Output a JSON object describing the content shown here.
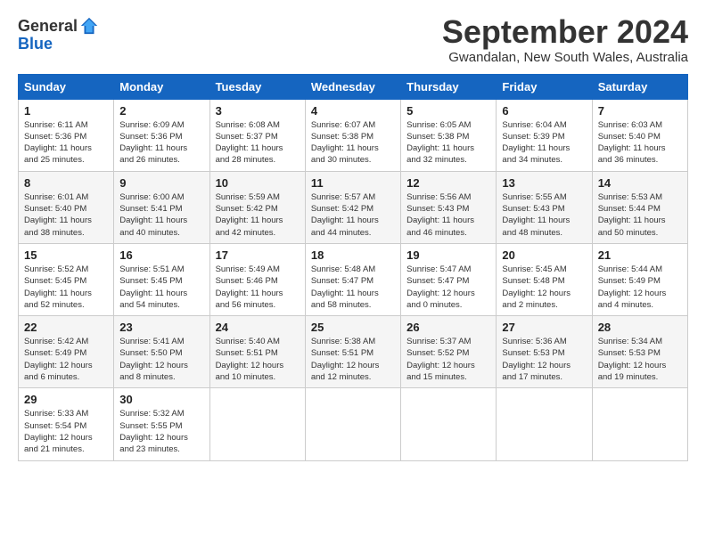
{
  "header": {
    "logo_general": "General",
    "logo_blue": "Blue",
    "month_title": "September 2024",
    "subtitle": "Gwandalan, New South Wales, Australia"
  },
  "days_of_week": [
    "Sunday",
    "Monday",
    "Tuesday",
    "Wednesday",
    "Thursday",
    "Friday",
    "Saturday"
  ],
  "weeks": [
    [
      {
        "day": "1",
        "info": "Sunrise: 6:11 AM\nSunset: 5:36 PM\nDaylight: 11 hours\nand 25 minutes."
      },
      {
        "day": "2",
        "info": "Sunrise: 6:09 AM\nSunset: 5:36 PM\nDaylight: 11 hours\nand 26 minutes."
      },
      {
        "day": "3",
        "info": "Sunrise: 6:08 AM\nSunset: 5:37 PM\nDaylight: 11 hours\nand 28 minutes."
      },
      {
        "day": "4",
        "info": "Sunrise: 6:07 AM\nSunset: 5:38 PM\nDaylight: 11 hours\nand 30 minutes."
      },
      {
        "day": "5",
        "info": "Sunrise: 6:05 AM\nSunset: 5:38 PM\nDaylight: 11 hours\nand 32 minutes."
      },
      {
        "day": "6",
        "info": "Sunrise: 6:04 AM\nSunset: 5:39 PM\nDaylight: 11 hours\nand 34 minutes."
      },
      {
        "day": "7",
        "info": "Sunrise: 6:03 AM\nSunset: 5:40 PM\nDaylight: 11 hours\nand 36 minutes."
      }
    ],
    [
      {
        "day": "8",
        "info": "Sunrise: 6:01 AM\nSunset: 5:40 PM\nDaylight: 11 hours\nand 38 minutes."
      },
      {
        "day": "9",
        "info": "Sunrise: 6:00 AM\nSunset: 5:41 PM\nDaylight: 11 hours\nand 40 minutes."
      },
      {
        "day": "10",
        "info": "Sunrise: 5:59 AM\nSunset: 5:42 PM\nDaylight: 11 hours\nand 42 minutes."
      },
      {
        "day": "11",
        "info": "Sunrise: 5:57 AM\nSunset: 5:42 PM\nDaylight: 11 hours\nand 44 minutes."
      },
      {
        "day": "12",
        "info": "Sunrise: 5:56 AM\nSunset: 5:43 PM\nDaylight: 11 hours\nand 46 minutes."
      },
      {
        "day": "13",
        "info": "Sunrise: 5:55 AM\nSunset: 5:43 PM\nDaylight: 11 hours\nand 48 minutes."
      },
      {
        "day": "14",
        "info": "Sunrise: 5:53 AM\nSunset: 5:44 PM\nDaylight: 11 hours\nand 50 minutes."
      }
    ],
    [
      {
        "day": "15",
        "info": "Sunrise: 5:52 AM\nSunset: 5:45 PM\nDaylight: 11 hours\nand 52 minutes."
      },
      {
        "day": "16",
        "info": "Sunrise: 5:51 AM\nSunset: 5:45 PM\nDaylight: 11 hours\nand 54 minutes."
      },
      {
        "day": "17",
        "info": "Sunrise: 5:49 AM\nSunset: 5:46 PM\nDaylight: 11 hours\nand 56 minutes."
      },
      {
        "day": "18",
        "info": "Sunrise: 5:48 AM\nSunset: 5:47 PM\nDaylight: 11 hours\nand 58 minutes."
      },
      {
        "day": "19",
        "info": "Sunrise: 5:47 AM\nSunset: 5:47 PM\nDaylight: 12 hours\nand 0 minutes."
      },
      {
        "day": "20",
        "info": "Sunrise: 5:45 AM\nSunset: 5:48 PM\nDaylight: 12 hours\nand 2 minutes."
      },
      {
        "day": "21",
        "info": "Sunrise: 5:44 AM\nSunset: 5:49 PM\nDaylight: 12 hours\nand 4 minutes."
      }
    ],
    [
      {
        "day": "22",
        "info": "Sunrise: 5:42 AM\nSunset: 5:49 PM\nDaylight: 12 hours\nand 6 minutes."
      },
      {
        "day": "23",
        "info": "Sunrise: 5:41 AM\nSunset: 5:50 PM\nDaylight: 12 hours\nand 8 minutes."
      },
      {
        "day": "24",
        "info": "Sunrise: 5:40 AM\nSunset: 5:51 PM\nDaylight: 12 hours\nand 10 minutes."
      },
      {
        "day": "25",
        "info": "Sunrise: 5:38 AM\nSunset: 5:51 PM\nDaylight: 12 hours\nand 12 minutes."
      },
      {
        "day": "26",
        "info": "Sunrise: 5:37 AM\nSunset: 5:52 PM\nDaylight: 12 hours\nand 15 minutes."
      },
      {
        "day": "27",
        "info": "Sunrise: 5:36 AM\nSunset: 5:53 PM\nDaylight: 12 hours\nand 17 minutes."
      },
      {
        "day": "28",
        "info": "Sunrise: 5:34 AM\nSunset: 5:53 PM\nDaylight: 12 hours\nand 19 minutes."
      }
    ],
    [
      {
        "day": "29",
        "info": "Sunrise: 5:33 AM\nSunset: 5:54 PM\nDaylight: 12 hours\nand 21 minutes."
      },
      {
        "day": "30",
        "info": "Sunrise: 5:32 AM\nSunset: 5:55 PM\nDaylight: 12 hours\nand 23 minutes."
      },
      {
        "day": "",
        "info": ""
      },
      {
        "day": "",
        "info": ""
      },
      {
        "day": "",
        "info": ""
      },
      {
        "day": "",
        "info": ""
      },
      {
        "day": "",
        "info": ""
      }
    ]
  ]
}
